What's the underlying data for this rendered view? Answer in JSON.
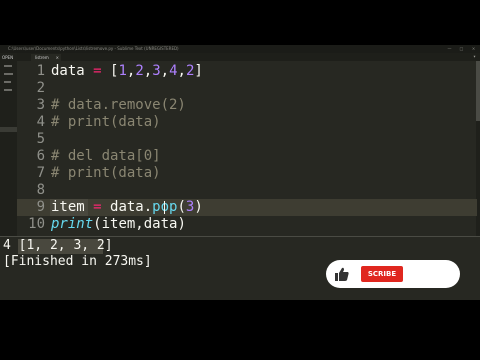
{
  "window": {
    "title": "C:\\Users\\user\\Documents\\python\\Lists\\listremove.py - Sublime Text (UNREGISTERED)",
    "controls": [
      "—",
      "□",
      "×"
    ]
  },
  "sidebar": {
    "header": "OPEN"
  },
  "tabs": [
    {
      "label": "listrem",
      "close": "×"
    }
  ],
  "tab_more": "▾",
  "editor": {
    "lines": [
      {
        "num": "1",
        "tokens": [
          {
            "t": "data ",
            "c": ""
          },
          {
            "t": "=",
            "c": "op"
          },
          {
            "t": " [",
            "c": ""
          },
          {
            "t": "1",
            "c": "num"
          },
          {
            "t": ",",
            "c": ""
          },
          {
            "t": "2",
            "c": "num"
          },
          {
            "t": ",",
            "c": ""
          },
          {
            "t": "3",
            "c": "num"
          },
          {
            "t": ",",
            "c": ""
          },
          {
            "t": "4",
            "c": "num"
          },
          {
            "t": ",",
            "c": ""
          },
          {
            "t": "2",
            "c": "num"
          },
          {
            "t": "]",
            "c": ""
          }
        ]
      },
      {
        "num": "2",
        "tokens": []
      },
      {
        "num": "3",
        "tokens": [
          {
            "t": "# data.remove(2)",
            "c": "cmt"
          }
        ]
      },
      {
        "num": "4",
        "tokens": [
          {
            "t": "# print(data)",
            "c": "cmt"
          }
        ]
      },
      {
        "num": "5",
        "tokens": []
      },
      {
        "num": "6",
        "tokens": [
          {
            "t": "# del data[0]",
            "c": "cmt"
          }
        ]
      },
      {
        "num": "7",
        "tokens": [
          {
            "t": "# print(data)",
            "c": "cmt"
          }
        ]
      },
      {
        "num": "8",
        "tokens": []
      },
      {
        "num": "9",
        "tokens": [
          {
            "t": "item ",
            "c": ""
          },
          {
            "t": "=",
            "c": "op"
          },
          {
            "t": " data.",
            "c": ""
          },
          {
            "t": "pop",
            "c": "meth"
          },
          {
            "t": "(",
            "c": ""
          },
          {
            "t": "3",
            "c": "num"
          },
          {
            "t": ")",
            "c": ""
          }
        ]
      },
      {
        "num": "10",
        "tokens": [
          {
            "t": "print",
            "c": "fn"
          },
          {
            "t": "(item,data)",
            "c": ""
          }
        ]
      }
    ]
  },
  "output": {
    "lines": [
      "4 [1, 2, 3, 2]",
      "[Finished in 273ms]"
    ]
  },
  "subscribe_overlay": {
    "button_label": "SCRIBE"
  },
  "colors": {
    "background": "#272822",
    "keyword": "#f92672",
    "number": "#ae81ff",
    "comment": "#8a8672",
    "function": "#66d9ef",
    "subscribe": "#e0271f"
  }
}
